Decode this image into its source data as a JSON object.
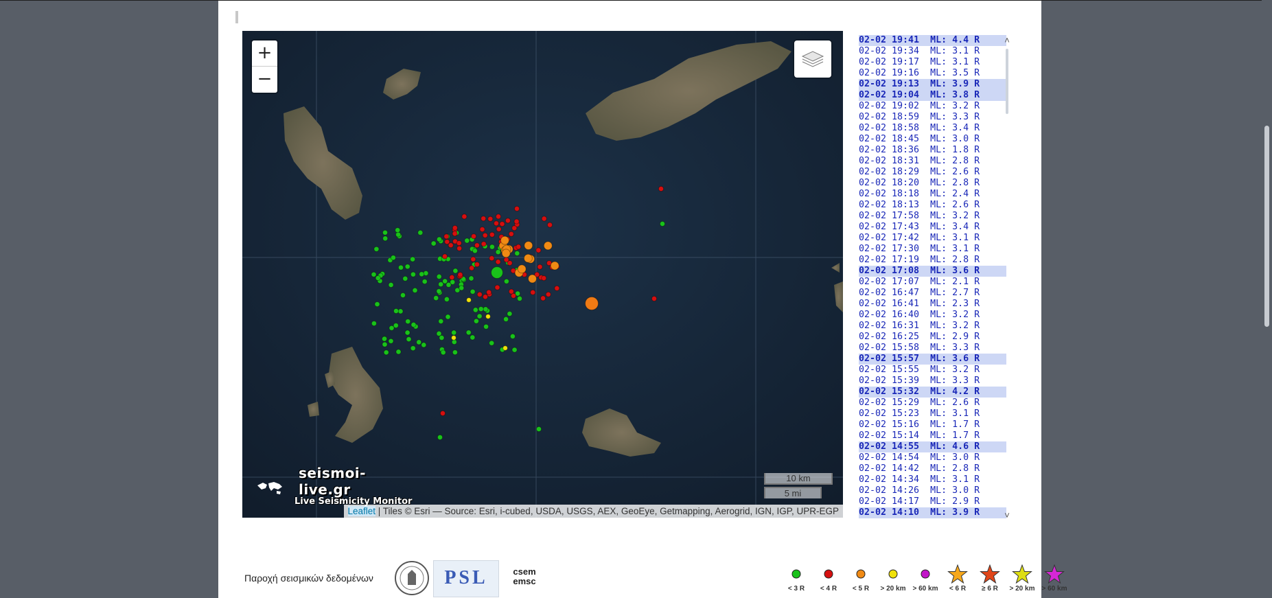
{
  "map": {
    "zoom_in_label": "+",
    "zoom_out_label": "−",
    "scale_km": "10 km",
    "scale_mi": "5 mi",
    "attribution_link": "Leaflet",
    "attribution_text": " | Tiles © Esri — Source: Esri, i-cubed, USDA, USGS, AEX, GeoEye, Getmapping, Aerogrid, IGN, IGP, UPR-EGP",
    "brand_site": "seismoi-live.gr",
    "brand_tagline": "Live Seismicity Monitor"
  },
  "quakes": [
    {
      "text": "02-02 19:41  ML: 4.4 R",
      "hl": true
    },
    {
      "text": "02-02 19:34  ML: 3.1 R",
      "hl": false
    },
    {
      "text": "02-02 19:17  ML: 3.1 R",
      "hl": false
    },
    {
      "text": "02-02 19:16  ML: 3.5 R",
      "hl": false
    },
    {
      "text": "02-02 19:13  ML: 3.9 R",
      "hl": true
    },
    {
      "text": "02-02 19:04  ML: 3.8 R",
      "hl": true
    },
    {
      "text": "02-02 19:02  ML: 3.2 R",
      "hl": false
    },
    {
      "text": "02-02 18:59  ML: 3.3 R",
      "hl": false
    },
    {
      "text": "02-02 18:58  ML: 3.4 R",
      "hl": false
    },
    {
      "text": "02-02 18:45  ML: 3.0 R",
      "hl": false
    },
    {
      "text": "02-02 18:36  ML: 1.8 R",
      "hl": false
    },
    {
      "text": "02-02 18:31  ML: 2.8 R",
      "hl": false
    },
    {
      "text": "02-02 18:29  ML: 2.6 R",
      "hl": false
    },
    {
      "text": "02-02 18:20  ML: 2.8 R",
      "hl": false
    },
    {
      "text": "02-02 18:18  ML: 2.4 R",
      "hl": false
    },
    {
      "text": "02-02 18:13  ML: 2.6 R",
      "hl": false
    },
    {
      "text": "02-02 17:58  ML: 3.2 R",
      "hl": false
    },
    {
      "text": "02-02 17:43  ML: 3.4 R",
      "hl": false
    },
    {
      "text": "02-02 17:42  ML: 3.1 R",
      "hl": false
    },
    {
      "text": "02-02 17:30  ML: 3.1 R",
      "hl": false
    },
    {
      "text": "02-02 17:19  ML: 2.8 R",
      "hl": false
    },
    {
      "text": "02-02 17:08  ML: 3.6 R",
      "hl": true
    },
    {
      "text": "02-02 17:07  ML: 2.1 R",
      "hl": false
    },
    {
      "text": "02-02 16:47  ML: 2.7 R",
      "hl": false
    },
    {
      "text": "02-02 16:41  ML: 2.3 R",
      "hl": false
    },
    {
      "text": "02-02 16:40  ML: 3.2 R",
      "hl": false
    },
    {
      "text": "02-02 16:31  ML: 3.2 R",
      "hl": false
    },
    {
      "text": "02-02 16:25  ML: 2.9 R",
      "hl": false
    },
    {
      "text": "02-02 15:58  ML: 3.3 R",
      "hl": false
    },
    {
      "text": "02-02 15:57  ML: 3.6 R",
      "hl": true
    },
    {
      "text": "02-02 15:55  ML: 3.2 R",
      "hl": false
    },
    {
      "text": "02-02 15:39  ML: 3.3 R",
      "hl": false
    },
    {
      "text": "02-02 15:32  ML: 4.2 R",
      "hl": true
    },
    {
      "text": "02-02 15:29  ML: 2.6 R",
      "hl": false
    },
    {
      "text": "02-02 15:23  ML: 3.1 R",
      "hl": false
    },
    {
      "text": "02-02 15:16  ML: 1.7 R",
      "hl": false
    },
    {
      "text": "02-02 15:14  ML: 1.7 R",
      "hl": false
    },
    {
      "text": "02-02 14:55  ML: 4.6 R",
      "hl": true
    },
    {
      "text": "02-02 14:54  ML: 3.0 R",
      "hl": false
    },
    {
      "text": "02-02 14:42  ML: 2.8 R",
      "hl": false
    },
    {
      "text": "02-02 14:34  ML: 3.1 R",
      "hl": false
    },
    {
      "text": "02-02 14:26  ML: 3.0 R",
      "hl": false
    },
    {
      "text": "02-02 14:17  ML: 2.9 R",
      "hl": false
    },
    {
      "text": "02-02 14:10  ML: 3.9 R",
      "hl": true
    }
  ],
  "footer": {
    "provider_label": "Παροχή σεισμικών δεδομένων",
    "logos": {
      "noa": "NOA seal",
      "psl": "PSL",
      "emsc": "csem emsc"
    },
    "psl_text": "PSL",
    "emsc_text": "csem emsc",
    "legend": [
      {
        "label": "< 3 R",
        "shape": "circle",
        "color": "#19c21a"
      },
      {
        "label": "< 4 R",
        "shape": "circle",
        "color": "#d60f0f"
      },
      {
        "label": "< 5 R",
        "shape": "circle",
        "color": "#f08a14"
      },
      {
        "label": "> 20 km",
        "shape": "circle",
        "color": "#f0e10a"
      },
      {
        "label": "> 60 km",
        "shape": "circle",
        "color": "#c215c8"
      },
      {
        "label": "< 6 R",
        "shape": "star",
        "color": "#f7a81b"
      },
      {
        "label": "≥ 6 R",
        "shape": "star",
        "color": "#e0461a"
      },
      {
        "label": "> 20 km",
        "shape": "star",
        "color": "#dede14"
      },
      {
        "label": "> 60 km",
        "shape": "star",
        "color": "#d627d6"
      }
    ]
  },
  "colors": {
    "ocean": "#15253a",
    "land": "#6e6450",
    "page_bg": "#585e67",
    "quake_text": "#1a28b8",
    "quake_highlight": "#cdd7f5"
  }
}
